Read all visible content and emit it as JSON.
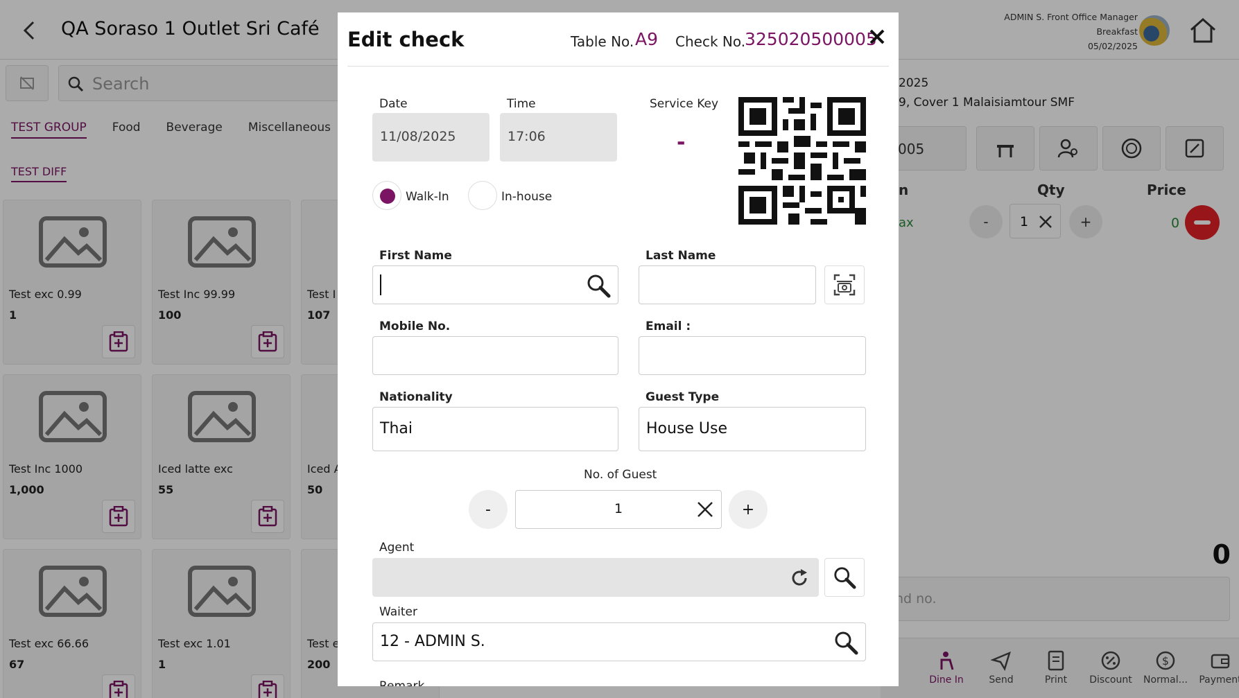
{
  "header": {
    "title": "QA Soraso 1 Outlet Sri Café",
    "user_line1": "ADMIN S. Front Office Manager",
    "user_line2": "Breakfast",
    "user_line3": "05/02/2025"
  },
  "search": {
    "placeholder": "Search"
  },
  "categories": [
    "TEST GROUP",
    "Food",
    "Beverage",
    "Miscellaneous"
  ],
  "subcategory": "TEST DIFF",
  "products": [
    {
      "name": "Test exc 0.99",
      "price": "1"
    },
    {
      "name": "Test Inc 99.99",
      "price": "100"
    },
    {
      "name": "Test I",
      "price": "107"
    },
    {
      "name": "Test Inc 1000",
      "price": "1,000"
    },
    {
      "name": "Iced latte exc",
      "price": "55"
    },
    {
      "name": "Iced A",
      "price": "50"
    },
    {
      "name": "Test exc 66.66",
      "price": "67"
    },
    {
      "name": "Test exc 1.01",
      "price": "1"
    },
    {
      "name": "Test e",
      "price": "200"
    }
  ],
  "right_panel": {
    "date_fragment": "2025",
    "guest_fragment": "9, Cover 1 Malaisiamtour SMF",
    "check_fragment": "005",
    "col_item": "n",
    "col_qty": "Qty",
    "col_price": "Price",
    "line_item": "ax",
    "line_qty": "1",
    "line_price": "0",
    "total": "0",
    "command_placeholder": "nd no."
  },
  "bottom_bar": [
    {
      "label": "Dine In",
      "icon": "dine-in-icon"
    },
    {
      "label": "Send",
      "icon": "send-icon"
    },
    {
      "label": "Print",
      "icon": "print-icon"
    },
    {
      "label": "Discount",
      "icon": "discount-icon"
    },
    {
      "label": "Normal...",
      "icon": "dollar-icon"
    },
    {
      "label": "Payment",
      "icon": "wallet-icon"
    }
  ],
  "modal": {
    "title": "Edit check",
    "table_label": "Table No.",
    "table_value": "A9",
    "check_label": "Check No.",
    "check_value": "325020500005",
    "date_label": "Date",
    "date_value": "11/08/2025",
    "time_label": "Time",
    "time_value": "17:06",
    "service_key_label": "Service Key",
    "service_key_value": "-",
    "walkin_label": "Walk-In",
    "inhouse_label": "In-house",
    "first_name_label": "First Name",
    "first_name_value": "",
    "last_name_label": "Last Name",
    "last_name_value": "",
    "mobile_label": "Mobile No.",
    "mobile_value": "",
    "email_label": "Email :",
    "email_value": "",
    "nationality_label": "Nationality",
    "nationality_value": "Thai",
    "guest_type_label": "Guest Type",
    "guest_type_value": "House Use",
    "guests_label": "No. of Guest",
    "guests_value": "1",
    "minus": "-",
    "plus": "+",
    "agent_label": "Agent",
    "agent_value": "",
    "waiter_label": "Waiter",
    "waiter_value": "12 - ADMIN S.",
    "remark_label": "Remark"
  },
  "colors": {
    "accent": "#7b1563",
    "remove": "#e32027",
    "positive": "#2a8a3a"
  }
}
